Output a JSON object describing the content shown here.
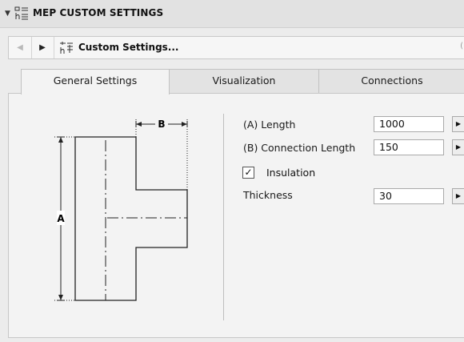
{
  "header": {
    "title": "MEP CUSTOM SETTINGS"
  },
  "nav": {
    "label": "Custom Settings...",
    "end_mark": "("
  },
  "tabs": [
    {
      "label": "General Settings",
      "active": true
    },
    {
      "label": "Visualization",
      "active": false
    },
    {
      "label": "Connections",
      "active": false
    }
  ],
  "diagram": {
    "dim_a": "A",
    "dim_b": "B"
  },
  "fields": {
    "length": {
      "label": "(A) Length",
      "value": "1000"
    },
    "connection_length": {
      "label": "(B) Connection Length",
      "value": "150"
    },
    "insulation": {
      "label": "Insulation",
      "checked": true,
      "mark": "✓"
    },
    "thickness": {
      "label": "Thickness",
      "value": "30"
    }
  },
  "icons": {
    "collapse": "triangle-down-icon",
    "settings": "mep-settings-icon",
    "prev": "arrow-left-icon",
    "next": "arrow-right-icon",
    "stepper": "arrow-right-small-icon"
  }
}
